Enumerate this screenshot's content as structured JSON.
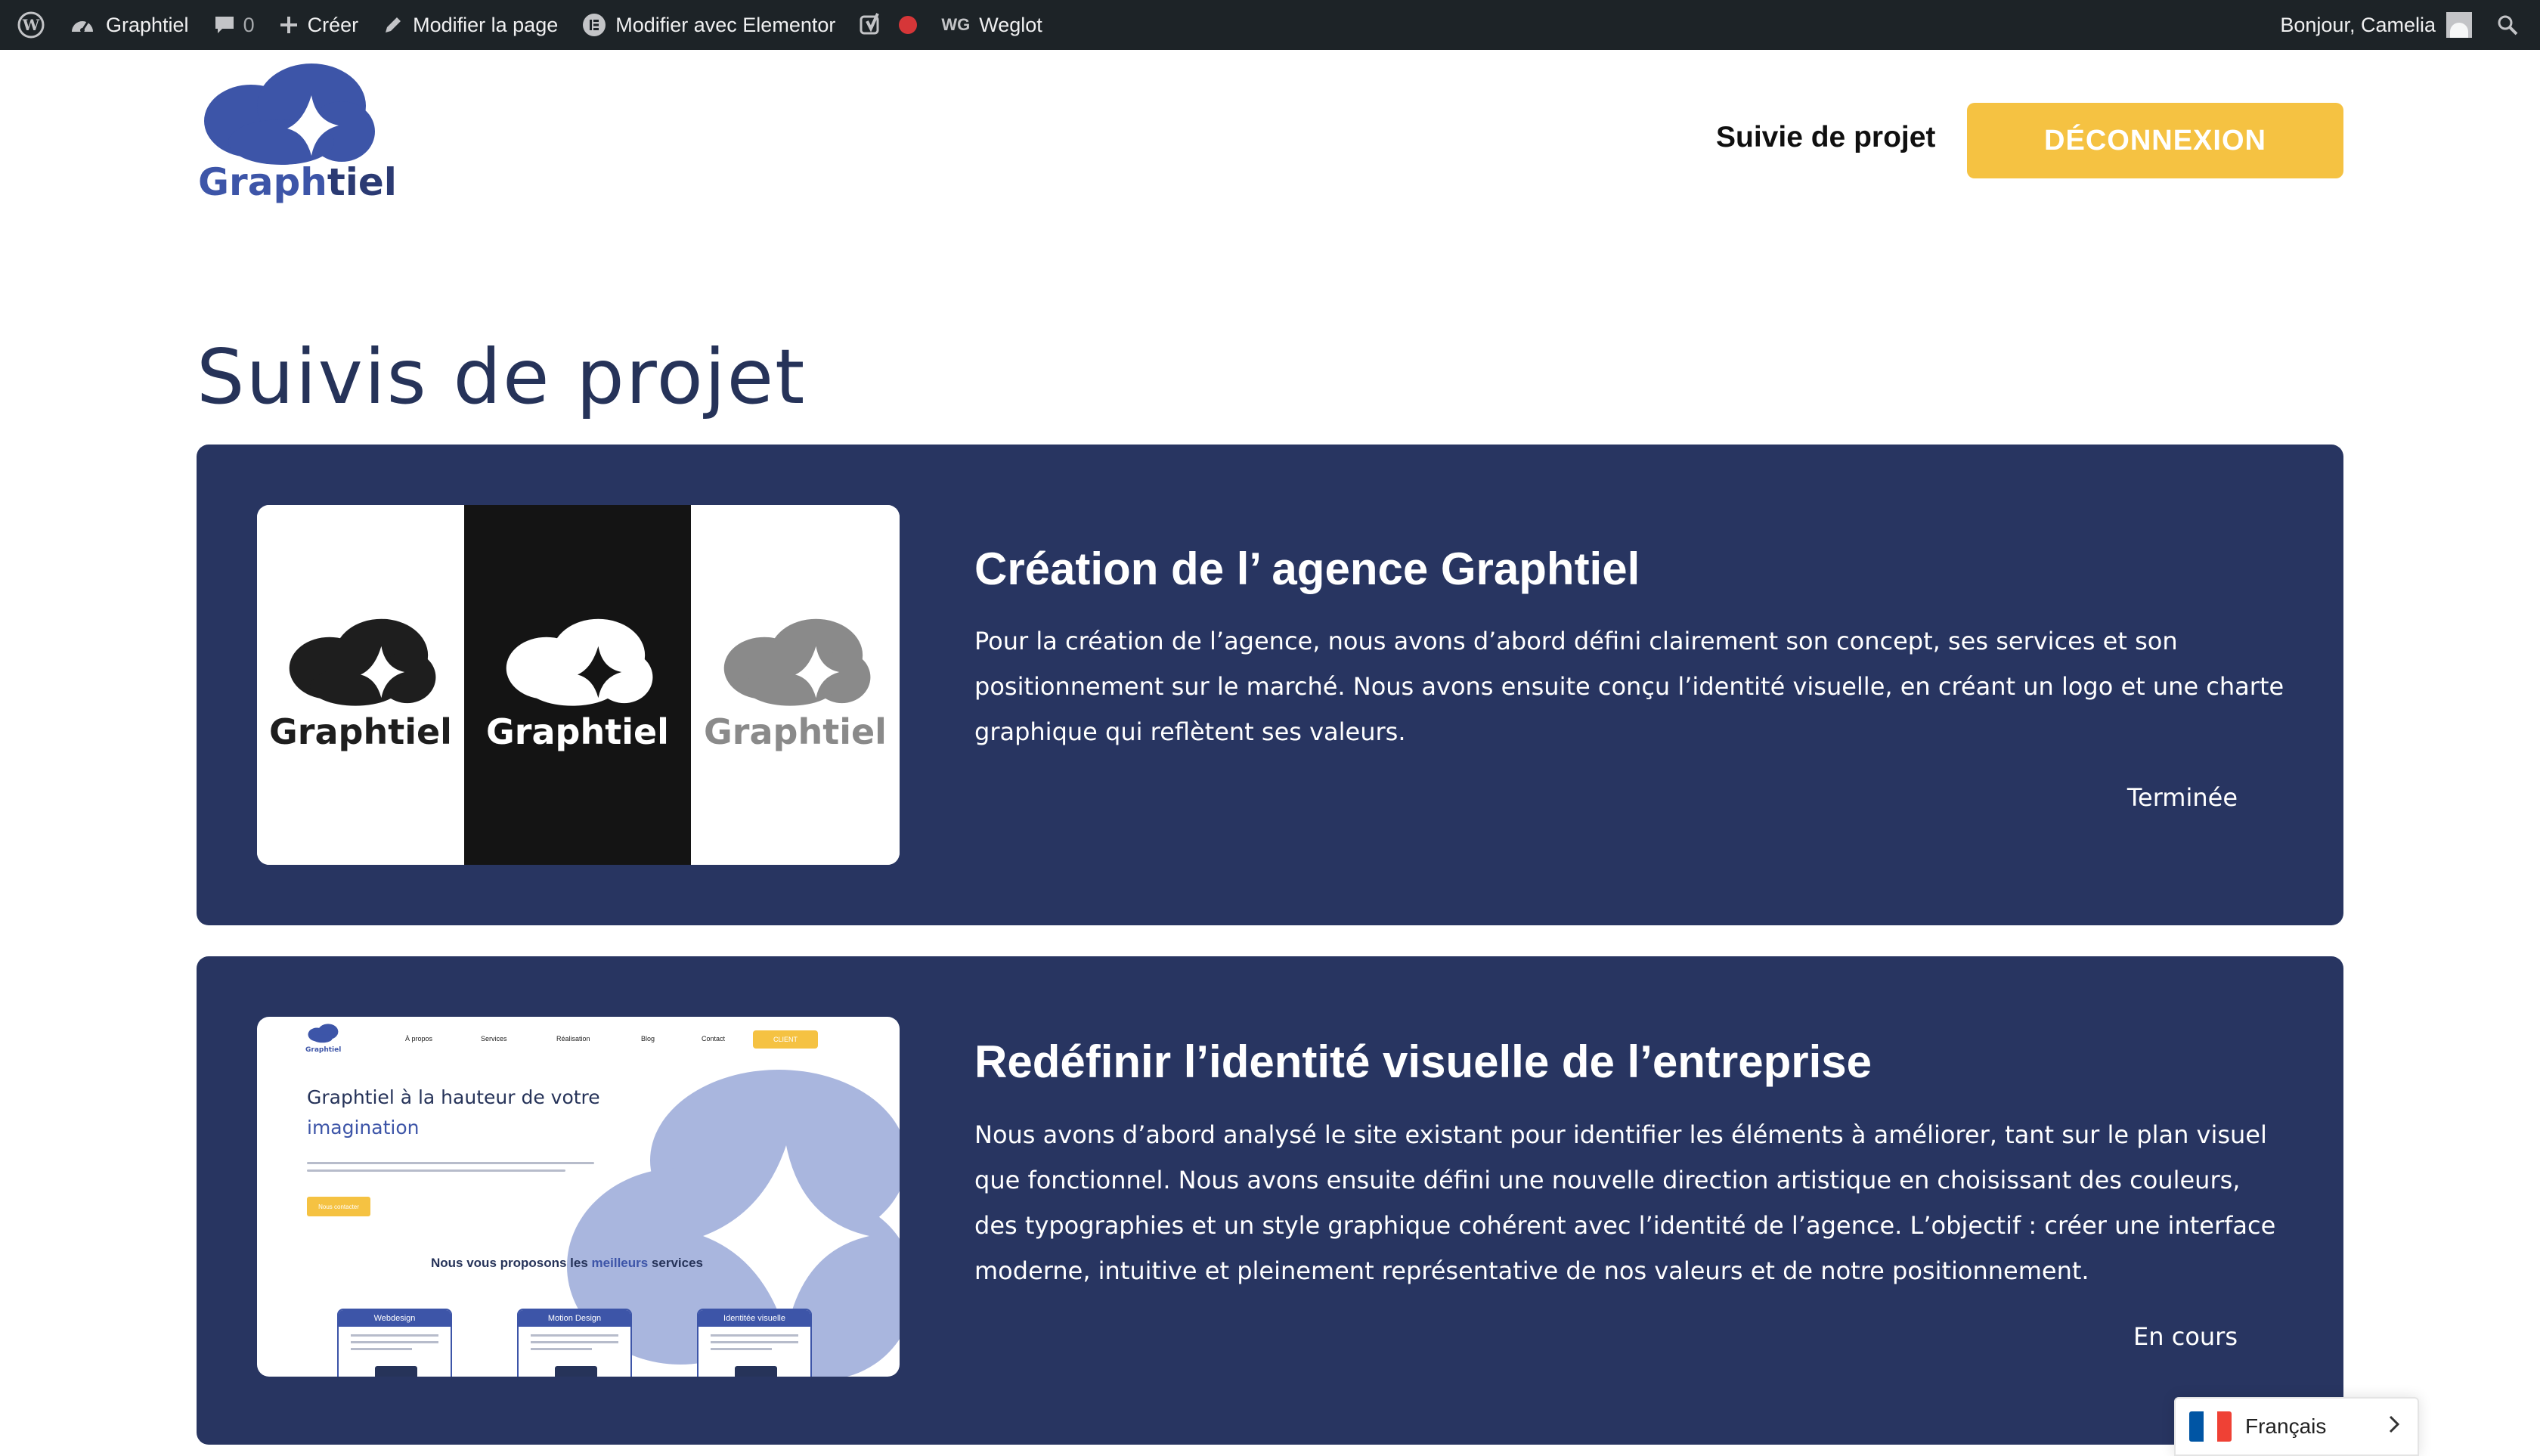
{
  "adminbar": {
    "site_name": "Graphtiel",
    "comments_count": "0",
    "create_label": "Créer",
    "edit_page_label": "Modifier la page",
    "elementor_label": "Modifier avec Elementor",
    "weglot_label": "Weglot",
    "weglot_badge": "WG",
    "greeting": "Bonjour, Camelia",
    "icons": [
      "wordpress-icon",
      "dashboard-icon",
      "comment-icon",
      "plus-icon",
      "pencil-icon",
      "elementor-icon",
      "yoast-icon",
      "status-dot-icon",
      "search-icon"
    ]
  },
  "header": {
    "logo_text_a": "Graph",
    "logo_text_b": "tiel",
    "nav_link": "Suivie de projet",
    "logout_button": "DÉCONNEXION",
    "colors": {
      "accent": "#f5c242",
      "brand_blue": "#3d55a8",
      "navy": "#283561"
    }
  },
  "page": {
    "title": "Suivis de projet"
  },
  "projects": [
    {
      "title": "Création de l’ agence Graphtiel",
      "description": "Pour la création de l’agence, nous avons d’abord défini clairement son concept, ses services et son positionnement sur le marché. Nous avons ensuite conçu l’identité visuelle, en créant un logo et une charte graphique qui reflètent ses valeurs.",
      "status": "Terminée",
      "thumbnail": {
        "logo_word": "Graphtiel"
      }
    },
    {
      "title": "Redéfinir l’identité visuelle de l’entreprise",
      "description": "Nous avons d’abord analysé le site existant pour identifier les éléments à améliorer, tant sur le plan visuel que fonctionnel. Nous avons ensuite défini une nouvelle direction artistique en choisissant des couleurs, des typographies et un style graphique cohérent avec l’identité de l’agence. L’objectif : créer une interface moderne, intuitive et pleinement représentative de nos valeurs et de notre positionnement.",
      "status": "En cours",
      "thumbnail": {
        "logo": "Graphtiel",
        "nav": [
          "À propos",
          "Services",
          "Réalisation",
          "Blog",
          "Contact"
        ],
        "client_button": "CLIENT",
        "hero_line1": "Graphtiel à la hauteur de votre",
        "hero_line2": "imagination",
        "cta": "Nous contacter",
        "services_a": "Nous vous proposons les ",
        "services_hl": "meilleurs",
        "services_b": " services",
        "boxes": [
          "Webdesign",
          "Motion Design",
          "Identitée visuelle"
        ]
      }
    }
  ],
  "language_switcher": {
    "label": "Français",
    "flag_colors": [
      "#0055a4",
      "#ffffff",
      "#ef4135"
    ]
  }
}
